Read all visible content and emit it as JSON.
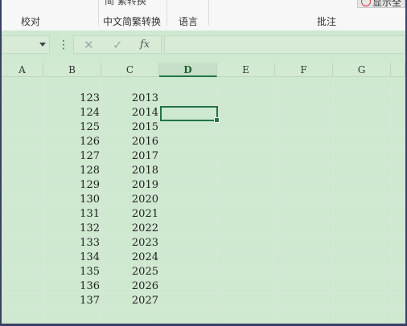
{
  "ribbon": {
    "groups": [
      "校对",
      "中文简繁转换",
      "语言",
      "批注"
    ],
    "partial_top_text": "中文简繁转换",
    "show_label": "显示全"
  },
  "formula_bar": {
    "cancel_icon": "cross-icon",
    "enter_icon": "check-icon",
    "fx_label": "fx",
    "formula": ""
  },
  "columns": [
    "A",
    "B",
    "C",
    "D",
    "E",
    "F",
    "G"
  ],
  "active_column": "D",
  "rows": [
    {
      "b": "123",
      "c": "2013"
    },
    {
      "b": "124",
      "c": "2014"
    },
    {
      "b": "125",
      "c": "2015"
    },
    {
      "b": "126",
      "c": "2016"
    },
    {
      "b": "127",
      "c": "2017"
    },
    {
      "b": "128",
      "c": "2018"
    },
    {
      "b": "129",
      "c": "2019"
    },
    {
      "b": "130",
      "c": "2020"
    },
    {
      "b": "131",
      "c": "2021"
    },
    {
      "b": "132",
      "c": "2022"
    },
    {
      "b": "133",
      "c": "2023"
    },
    {
      "b": "134",
      "c": "2024"
    },
    {
      "b": "135",
      "c": "2025"
    },
    {
      "b": "136",
      "c": "2026"
    },
    {
      "b": "137",
      "c": "2027"
    }
  ],
  "colors": {
    "accent": "#217346",
    "sheet_bg": "#cfe8d0"
  }
}
